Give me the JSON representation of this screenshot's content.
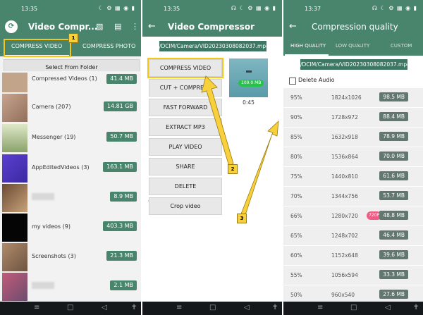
{
  "panels": {
    "left": {
      "status_time": "13:35",
      "title": "Video Compr...",
      "tabs": [
        {
          "label": "COMPRESS VIDEO"
        },
        {
          "label": "COMPRESS PHOTO"
        }
      ],
      "select_button": "Select From Folder",
      "folders": [
        {
          "name": "Compressed Videos (1)",
          "size": "41.4 MB"
        },
        {
          "name": "Camera (207)",
          "size": "14.81 GB"
        },
        {
          "name": "Messenger (19)",
          "size": "50.7 MB"
        },
        {
          "name": "AppEditedVideos (3)",
          "size": "163.1 MB"
        },
        {
          "name": "",
          "size": "8.9 MB"
        },
        {
          "name": "my videos (9)",
          "size": "403.3 MB"
        },
        {
          "name": "Screenshots (3)",
          "size": "21.3 MB"
        },
        {
          "name": "",
          "size": "2.1 MB"
        }
      ],
      "marker": "1"
    },
    "middle": {
      "status_time": "13:35",
      "title": "Video Compressor",
      "path": "/DCIM/Camera/VID20230308082037.mp4",
      "actions": [
        {
          "label": "COMPRESS VIDEO"
        },
        {
          "label": "CUT + COMPRESS"
        },
        {
          "label": "FAST FORWARD"
        },
        {
          "label": "EXTRACT MP3"
        },
        {
          "label": "PLAY VIDEO"
        },
        {
          "label": "SHARE"
        },
        {
          "label": "DELETE"
        },
        {
          "label": "Crop video"
        }
      ],
      "ad_label": "AD",
      "preview_size": "109.0 MB",
      "preview_duration": "0:45",
      "marker": "2"
    },
    "right": {
      "status_time": "13:37",
      "title": "Compression quality",
      "tabs": [
        {
          "label": "HIGH QUALITY"
        },
        {
          "label": "LOW QUALITY"
        },
        {
          "label": "CUSTOM"
        }
      ],
      "path": "/DCIM/Camera/VID20230308082037.mp4",
      "delete_audio_label": "Delete Audio",
      "qualities": [
        {
          "pct": "95%",
          "res": "1824x1026",
          "size": "98.5 MB"
        },
        {
          "pct": "90%",
          "res": "1728x972",
          "size": "88.4 MB"
        },
        {
          "pct": "85%",
          "res": "1632x918",
          "size": "78.9 MB"
        },
        {
          "pct": "80%",
          "res": "1536x864",
          "size": "70.0 MB"
        },
        {
          "pct": "75%",
          "res": "1440x810",
          "size": "61.6 MB"
        },
        {
          "pct": "70%",
          "res": "1344x756",
          "size": "53.7 MB"
        },
        {
          "pct": "66%",
          "res": "1280x720",
          "size": "48.8 MB",
          "badge": "720P"
        },
        {
          "pct": "65%",
          "res": "1248x702",
          "size": "46.4 MB"
        },
        {
          "pct": "60%",
          "res": "1152x648",
          "size": "39.6 MB"
        },
        {
          "pct": "55%",
          "res": "1056x594",
          "size": "33.3 MB"
        },
        {
          "pct": "50%",
          "res": "960x540",
          "size": "27.6 MB"
        }
      ],
      "marker": "3"
    }
  },
  "colors": {
    "primary": "#48856c",
    "highlight": "#f5c518",
    "badge": "#f25c84",
    "nav": "#15181b"
  }
}
